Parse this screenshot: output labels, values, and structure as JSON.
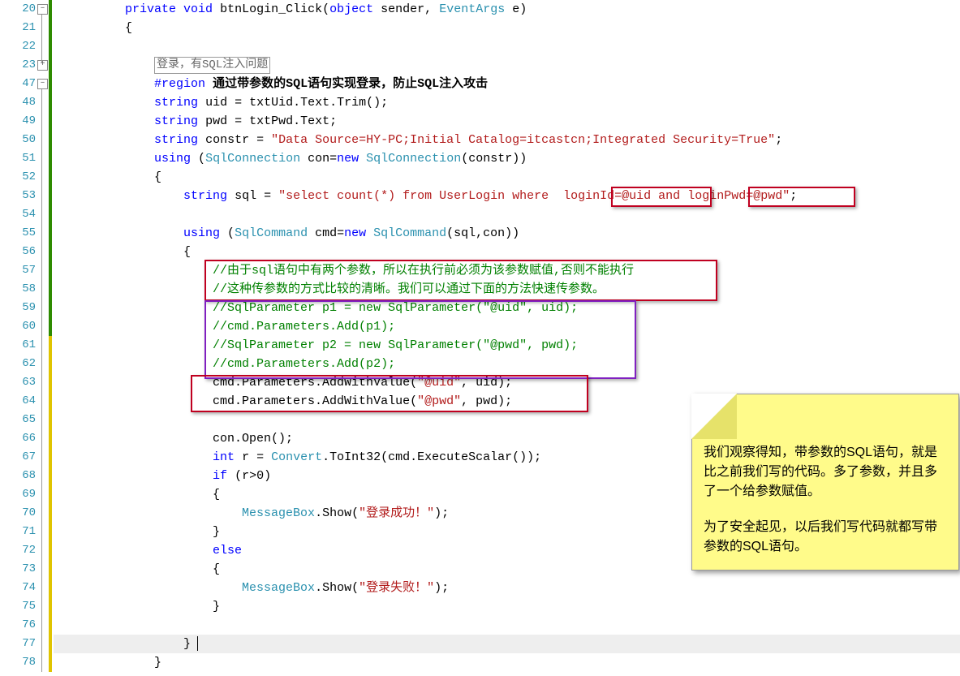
{
  "lineNumbers": [
    "20",
    "21",
    "22",
    "23",
    "47",
    "48",
    "49",
    "50",
    "51",
    "52",
    "53",
    "54",
    "55",
    "56",
    "57",
    "58",
    "59",
    "60",
    "61",
    "62",
    "63",
    "64",
    "65",
    "66",
    "67",
    "68",
    "69",
    "70",
    "71",
    "72",
    "73",
    "74",
    "75",
    "76",
    "77",
    "78"
  ],
  "code": {
    "kw_private": "private",
    "kw_void": "void",
    "sig_name": "btnLogin_Click",
    "kw_object": "object",
    "sender": "sender",
    "eventargs": "EventArgs",
    "e_arg": "e",
    "brace_open": "{",
    "brace_close": "}",
    "paren_open": "(",
    "paren_close": ")",
    "hint": "登录，有SQL注入问题",
    "region_kw": "#region",
    "region_text": "通过带参数的SQL语句实现登录，防止SQL注入攻击",
    "kw_string": "string",
    "uid_decl": "uid = txtUid.Text.Trim();",
    "pwd_decl": "pwd = txtPwd.Text;",
    "constr_decl": "constr = ",
    "constr_str": "\"Data Source=HY-PC;Initial Catalog=itcastcn;Integrated Security=True\"",
    "kw_using": "using",
    "sqlcon": "SqlConnection",
    "con_var": "con",
    "kw_new": "new",
    "constr_arg": "(constr))",
    "sql_decl": "sql = ",
    "sql_open": "\"select count(*) from UserLogin where  ",
    "sql_h1": "loginId=@uid",
    "sql_mid": " and ",
    "sql_h2": "loginPwd=@pwd",
    "sql_end": "\"",
    "sqlcmd": "SqlCommand",
    "cmd_var": "cmd",
    "cmd_args": "(sql,con))",
    "comment1": "//由于sql语句中有两个参数，所以在执行前必须为该参数赋值,否则不能执行",
    "comment2": "//这种传参数的方式比较的清晰。我们可以通过下面的方法快速传参数。",
    "comment3": "//SqlParameter p1 = new SqlParameter(\"@uid\", uid);",
    "comment4": "//cmd.Parameters.Add(p1);",
    "comment5": "//SqlParameter p2 = new SqlParameter(\"@pwd\", pwd);",
    "comment6": "//cmd.Parameters.Add(p2);",
    "add1a": "cmd.Parameters.AddWithValue(",
    "add1s": "\"@uid\"",
    "add1b": ", uid);",
    "add2a": "cmd.Parameters.AddWithValue(",
    "add2s": "\"@pwd\"",
    "add2b": ", pwd);",
    "open": "con.Open();",
    "kw_int": "int",
    "r_decl": "r = ",
    "convert": "Convert",
    "toint": ".ToInt32(cmd.ExecuteScalar());",
    "kw_if": "if",
    "if_cond": "(r>0)",
    "msgbox": "MessageBox",
    "show": ".Show(",
    "msg_ok": "\"登录成功！\"",
    "msg_fail": "\"登录失败！\"",
    "showend": ");",
    "kw_else": "else",
    "cursor": "}"
  },
  "sticky": {
    "p1": "我们观察得知，带参数的SQL语句，就是比之前我们写的代码。多了参数，并且多了一个给参数赋值。",
    "p2": "为了安全起见，以后我们写代码就都写带参数的SQL语句。"
  }
}
